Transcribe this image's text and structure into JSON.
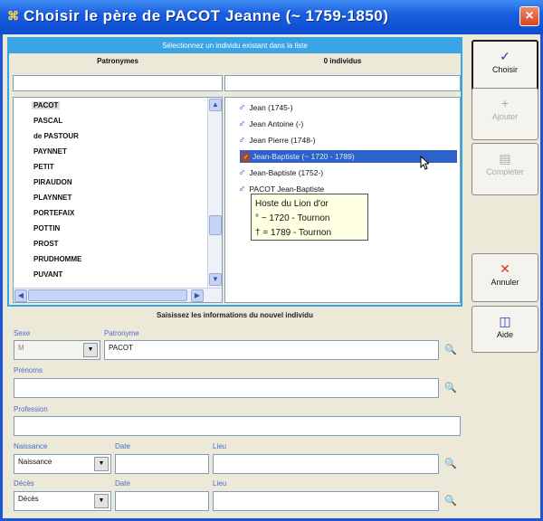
{
  "window": {
    "title": "Choisir le père de PACOT Jeanne (~ 1759-1850)",
    "title_icon": "app-icon",
    "close_label": "×"
  },
  "selection": {
    "header": "Sélectionnez un individu existant dans la liste",
    "col_surnames": "Patronymes",
    "col_individuals": "0 individus",
    "surnames": [
      "PACOT",
      "PASCAL",
      "de PASTOUR",
      "PAYNNET",
      "PETIT",
      "PIRAUDON",
      "PLAYNNET",
      "PORTEFAIX",
      "POTTIN",
      "PROST",
      "PRUDHOMME",
      "PUVANT"
    ],
    "individuals": [
      {
        "sex": "♂",
        "label": "Jean (1745-)"
      },
      {
        "sex": "♂",
        "label": "Jean Antoine (-)"
      },
      {
        "sex": "♂",
        "label": "Jean Pierre (1748-)"
      },
      {
        "sex": "♂",
        "label": "Jean-Baptiste (~ 1720 - 1789)"
      },
      {
        "sex": "♂",
        "label": "Jean-Baptiste (1752-)"
      },
      {
        "sex": "♂",
        "label": "PACOT Jean-Baptiste"
      }
    ],
    "tooltip": [
      "Hoste du Lion d'or",
      "° ~ 1720 - Tournon",
      "† = 1789 - Tournon"
    ]
  },
  "buttons": {
    "choose": {
      "label": "Choisir",
      "icon": "check-icon"
    },
    "add": {
      "label": "Ajouter",
      "icon": "plus-icon"
    },
    "complete": {
      "label": "Compléter",
      "icon": "document-icon"
    },
    "cancel": {
      "label": "Annuler",
      "icon": "x-icon"
    },
    "help": {
      "label": "Aide",
      "icon": "help-icon"
    }
  },
  "form": {
    "title": "Saisissez les informations du nouvel individu",
    "sex_label": "Sexe",
    "sex_value": "M",
    "surname_label": "Patronyme",
    "surname_value": "PACOT",
    "firstname_label": "Prénoms",
    "firstname_value": "",
    "profession_label": "Profession",
    "profession_value": "",
    "birth_label": "Naissance",
    "birth_value": "Naissance",
    "birth_date_label": "Date",
    "birth_place_label": "Lieu",
    "death_label": "Décès",
    "death_value": "Décès",
    "death_date_label": "Date",
    "death_place_label": "Lieu"
  }
}
